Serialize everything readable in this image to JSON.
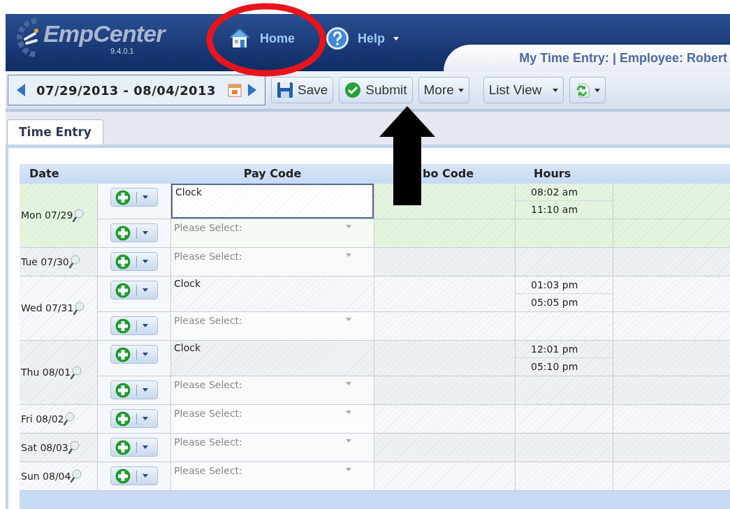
{
  "header": {
    "logo": "EmpCenter",
    "version": "9.4.0.1",
    "nav": [
      {
        "label": "Home",
        "kind": "home"
      },
      {
        "label": "Help",
        "kind": "help"
      }
    ],
    "page_title": "My Time Entry: | Employee: Robert"
  },
  "toolbar": {
    "date_range": "07/29/2013 - 08/04/2013",
    "buttons": [
      {
        "label": "Save",
        "kind": "save"
      },
      {
        "label": "Submit",
        "kind": "submit"
      },
      {
        "label": "More",
        "kind": "menu"
      },
      {
        "label": "List View",
        "kind": "menu"
      },
      {
        "kind": "refresh"
      }
    ]
  },
  "tabs": [
    {
      "label": "Time Entry",
      "selected": true
    }
  ],
  "table": {
    "columns": [
      "Date",
      "Pay Code",
      "bo Code",
      "Hours"
    ],
    "days": [
      {
        "date": "Mon 07/29",
        "selected": true,
        "entries": [
          {
            "kind": "clock",
            "pay_code": "Clock",
            "times": [
              "08:02 am",
              "11:10 am"
            ]
          },
          {
            "kind": "select",
            "placeholder": "Please Select:"
          }
        ]
      },
      {
        "date": "Tue 07/30",
        "selected": false,
        "entries": [
          {
            "kind": "select",
            "placeholder": "Please Select:"
          }
        ]
      },
      {
        "date": "Wed 07/31",
        "selected": false,
        "entries": [
          {
            "kind": "clock",
            "pay_code": "Clock",
            "times": [
              "01:03 pm",
              "05:05 pm"
            ]
          },
          {
            "kind": "select",
            "placeholder": "Please Select:"
          }
        ]
      },
      {
        "date": "Thu 08/01",
        "selected": false,
        "entries": [
          {
            "kind": "clock",
            "pay_code": "Clock",
            "times": [
              "12:01 pm",
              "05:10 pm"
            ]
          },
          {
            "kind": "select",
            "placeholder": "Please Select:"
          }
        ]
      },
      {
        "date": "Fri 08/02",
        "selected": false,
        "entries": [
          {
            "kind": "select",
            "placeholder": "Please Select:"
          }
        ]
      },
      {
        "date": "Sat 08/03",
        "selected": false,
        "entries": [
          {
            "kind": "select",
            "placeholder": "Please Select:"
          }
        ]
      },
      {
        "date": "Sun 08/04",
        "selected": false,
        "entries": [
          {
            "kind": "select",
            "placeholder": "Please Select:"
          }
        ]
      }
    ]
  }
}
